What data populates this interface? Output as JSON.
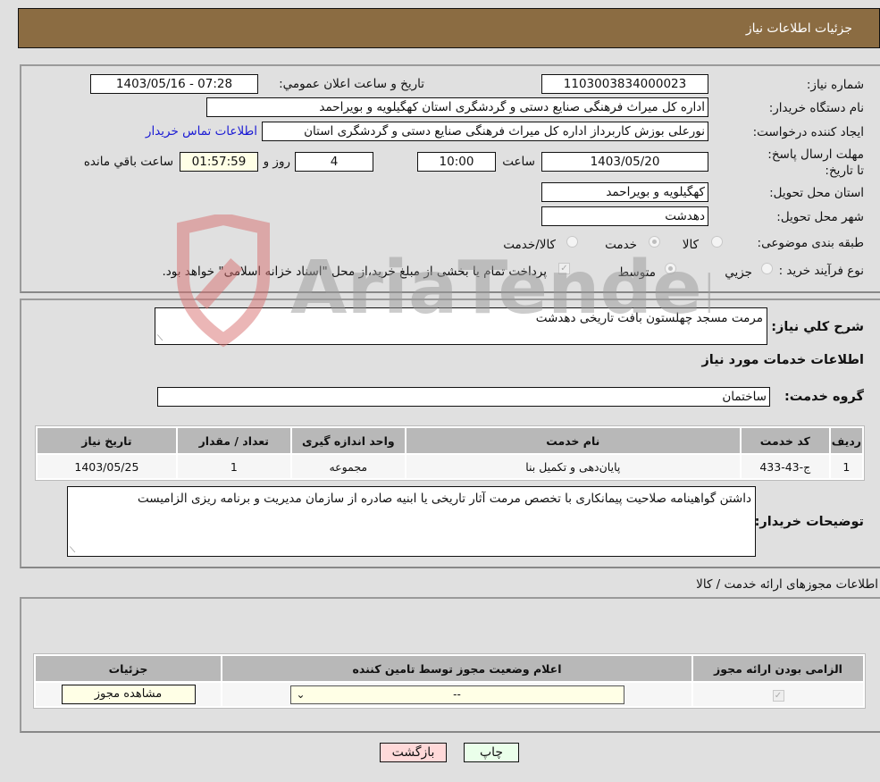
{
  "header": {
    "title": "جزئیات اطلاعات نیاز"
  },
  "form": {
    "need_number_label": "شماره نیاز:",
    "need_number": "1103003834000023",
    "announce_label": "تاريخ و ساعت اعلان عمومي:",
    "announce_value": "1403/05/16 - 07:28",
    "buyer_org_label": "نام دستگاه خریدار:",
    "buyer_org": "اداره کل میراث فرهنگی  صنایع دستی و گردشگری استان کهگیلویه و بویراحمد",
    "requester_label": "ایجاد کننده درخواست:",
    "requester": "نورعلی بوزش کاربرداز اداره کل میراث فرهنگی  صنایع دستی و گردشگری استان",
    "contact_link": "اطلاعات تماس خریدار",
    "deadline_label": "مهلت ارسال پاسخ: تا تاریخ:",
    "deadline_date": "1403/05/20",
    "time_label": "ساعت",
    "deadline_time": "10:00",
    "days_value": "4",
    "days_label": "روز و",
    "remaining_time": "01:57:59",
    "remaining_label": "ساعت باقي مانده",
    "province_label": "استان محل تحویل:",
    "province": "کهگیلویه و بویراحمد",
    "city_label": "شهر محل تحویل:",
    "city": "دهدشت",
    "category_label": "طبقه بندی موضوعی:",
    "category_options": [
      {
        "label": "کالا",
        "selected": false
      },
      {
        "label": "خدمت",
        "selected": true
      },
      {
        "label": "کالا/خدمت",
        "selected": false
      }
    ],
    "process_label": "نوع فرآیند خرید :",
    "process_options": [
      {
        "label": "جزيي",
        "selected": false
      },
      {
        "label": "متوسط",
        "selected": true
      }
    ],
    "treasury_note": "پرداخت تمام یا بخشی از مبلغ خرید،از محل \"اسناد خزانه اسلامی\" خواهد بود.",
    "treasury_checked": true
  },
  "details": {
    "summary_label": "شرح کلي نیاز:",
    "summary": "مرمت مسجد چهلستون بافت تاریخی دهدشت",
    "services_title": "اطلاعات خدمات مورد نیاز",
    "service_group_label": "گروه خدمت:",
    "service_group": "ساختمان",
    "table": {
      "headers": [
        "ردیف",
        "کد خدمت",
        "نام خدمت",
        "واحد اندازه گیری",
        "تعداد / مقدار",
        "تاریخ نیاز"
      ],
      "rows": [
        [
          "1",
          "ج-43-433",
          "پایان‌دهی و تکمیل بنا",
          "مجموعه",
          "1",
          "1403/05/25"
        ]
      ]
    },
    "buyer_notes_label": "توضیحات خریدار:",
    "buyer_notes": "داشتن گواهینامه صلاحیت پیمانکاری با تخصص مرمت آثار تاریخی یا ابنیه صادره از سازمان مدیریت و برنامه ریزی الزامیست"
  },
  "permits": {
    "title": "اطلاعات مجوزهای ارائه خدمت / کالا",
    "headers": [
      "الزامی بودن ارائه مجوز",
      "اعلام وضعیت مجوز توسط تامین کننده",
      "جزئیات"
    ],
    "row": {
      "required_checked": true,
      "status_value": "--",
      "view_button": "مشاهده مجوز"
    }
  },
  "actions": {
    "print": "چاپ",
    "back": "بازگشت"
  },
  "watermark": {
    "text": "AriaTender.neT"
  }
}
